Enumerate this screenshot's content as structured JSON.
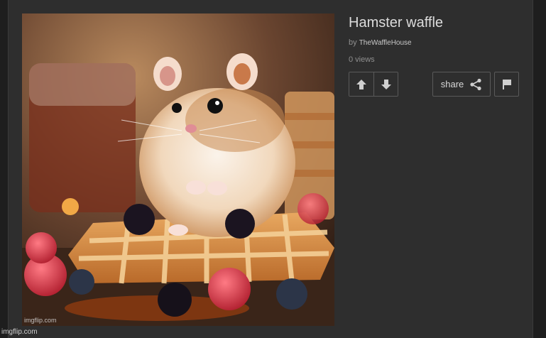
{
  "post": {
    "title": "Hamster waffle",
    "by_label": "by",
    "author": "TheWaffleHouse",
    "views": "0 views",
    "image_alt": "Hamster sitting on a waffle with berries"
  },
  "actions": {
    "share_label": "share",
    "upvote_icon": "arrow-up-icon",
    "downvote_icon": "arrow-down-icon",
    "share_icon": "share-icon",
    "flag_icon": "flag-icon"
  },
  "watermarks": {
    "image": "imgflip.com",
    "page": "imgflip.com"
  },
  "colors": {
    "background": "#1e1e1e",
    "panel": "#2e2e2e",
    "text": "#dcdcdc",
    "muted": "#8f8f8f",
    "border": "#5a5a5a"
  }
}
